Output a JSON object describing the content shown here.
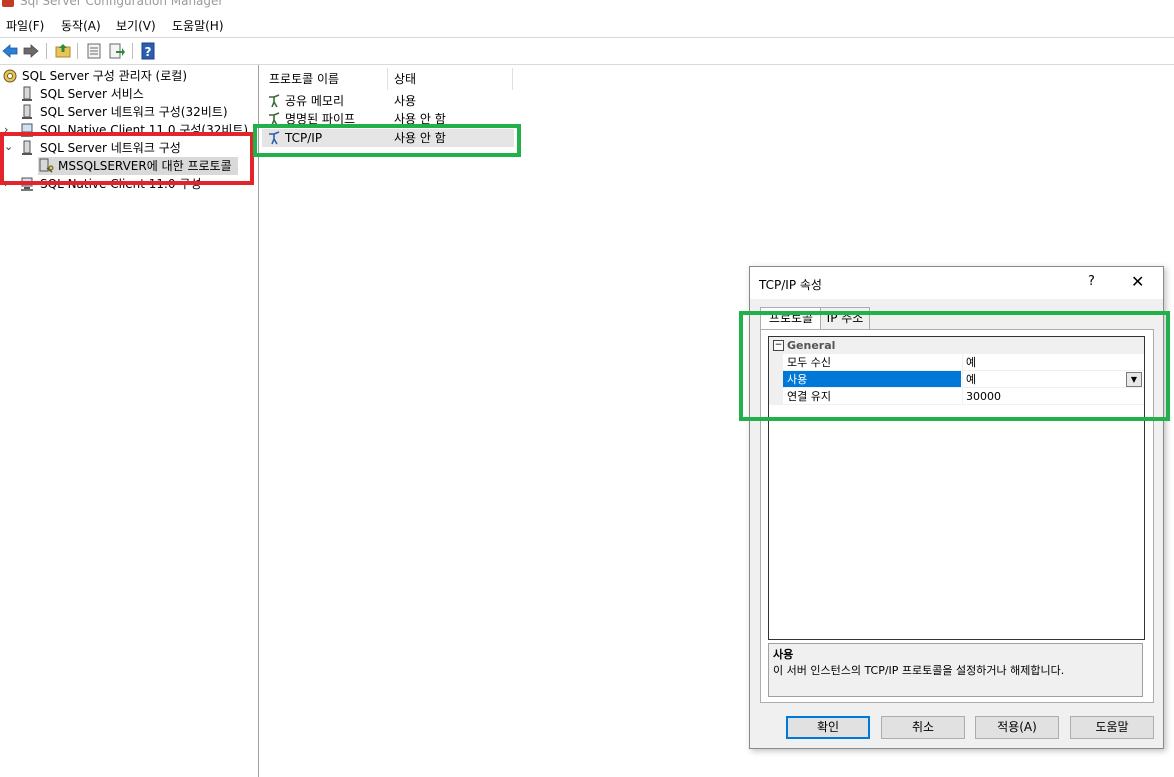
{
  "window": {
    "title": "Sql Server Configuration Manager"
  },
  "menu": [
    "파일(F)",
    "동작(A)",
    "보기(V)",
    "도움말(H)"
  ],
  "tree": {
    "root": "SQL Server 구성 관리자 (로컬)",
    "items": [
      {
        "label": "SQL Server 서비스"
      },
      {
        "label": "SQL Server 네트워크 구성(32비트)"
      },
      {
        "label": "SQL Native Client 11.0 구성(32비트)"
      },
      {
        "label": "SQL Server 네트워크 구성"
      },
      {
        "label": "MSSQLSERVER에 대한 프로토콜"
      },
      {
        "label": "SQL Native Client 11.0 구성"
      }
    ]
  },
  "list": {
    "headers": {
      "name": "프로토콜 이름",
      "status": "상태"
    },
    "rows": [
      {
        "name": "공유 메모리",
        "status": "사용"
      },
      {
        "name": "명명된 파이프",
        "status": "사용 안 함"
      },
      {
        "name": "TCP/IP",
        "status": "사용 안 함"
      }
    ]
  },
  "dialog": {
    "title": "TCP/IP 속성",
    "help_glyph": "?",
    "close_glyph": "✕",
    "tabs": [
      "프로토콜",
      "IP 주소"
    ],
    "category": "General",
    "category_toggle": "−",
    "properties": [
      {
        "name": "모두 수신",
        "value": "예"
      },
      {
        "name": "사용",
        "value": "예"
      },
      {
        "name": "연결 유지",
        "value": "30000"
      }
    ],
    "description_title": "사용",
    "description_text": "이 서버 인스턴스의 TCP/IP 프로토콜을 설정하거나 해제합니다.",
    "buttons": {
      "ok": "확인",
      "cancel": "취소",
      "apply": "적용(A)",
      "help": "도움말"
    }
  },
  "colors": {
    "annotation_red": "#e3242b",
    "annotation_green": "#22b04b",
    "selection": "#0078d7"
  }
}
